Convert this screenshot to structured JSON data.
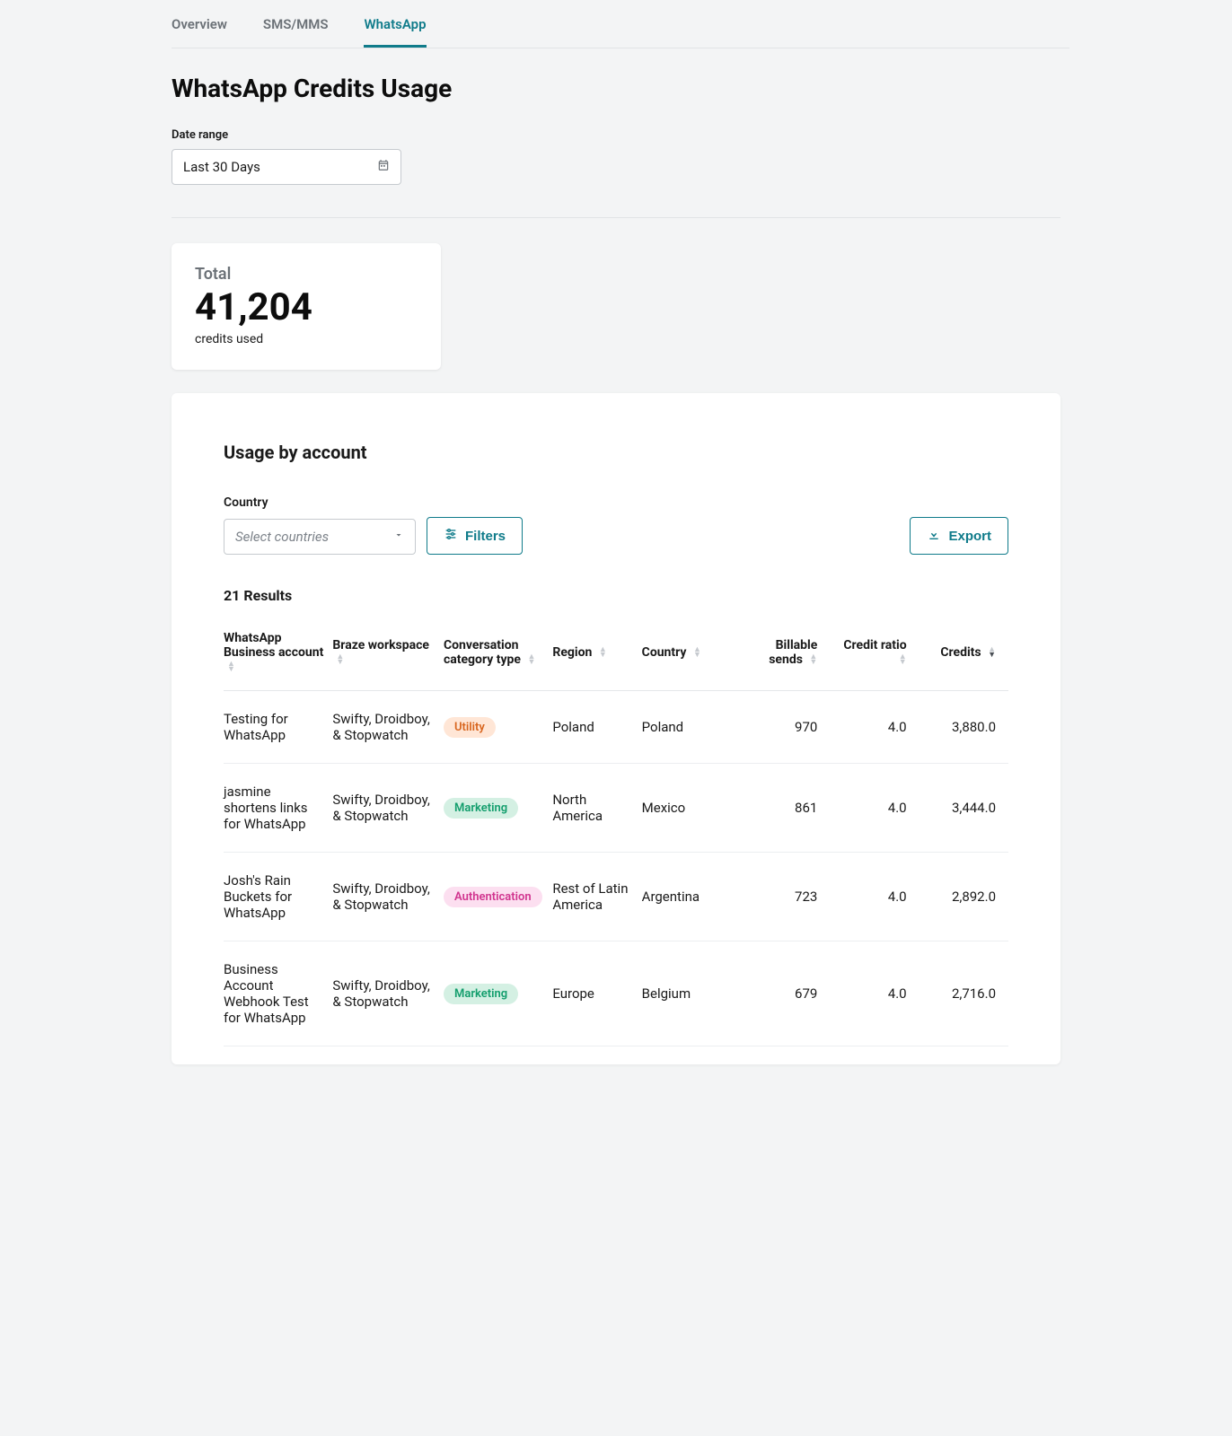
{
  "tabs": [
    {
      "label": "Overview",
      "active": false
    },
    {
      "label": "SMS/MMS",
      "active": false
    },
    {
      "label": "WhatsApp",
      "active": true
    }
  ],
  "page_title": "WhatsApp Credits Usage",
  "date_range": {
    "label": "Date range",
    "value": "Last 30 Days"
  },
  "total_card": {
    "label": "Total",
    "value": "41,204",
    "sub": "credits used"
  },
  "section_title": "Usage by account",
  "country_filter": {
    "label": "Country",
    "placeholder": "Select countries"
  },
  "buttons": {
    "filters": "Filters",
    "export": "Export"
  },
  "results_count": "21 Results",
  "columns": {
    "account": "WhatsApp Business account",
    "workspace": "Braze workspace",
    "type": "Conversation category type",
    "region": "Region",
    "country": "Country",
    "sends": "Billable sends",
    "ratio": "Credit ratio",
    "credits": "Credits"
  },
  "pill_labels": {
    "utility": "Utility",
    "marketing": "Marketing",
    "authentication": "Authentication"
  },
  "rows": [
    {
      "account": "Testing for WhatsApp",
      "workspace": "Swifty, Droidboy, & Stopwatch",
      "type": "utility",
      "region": "Poland",
      "country": "Poland",
      "sends": "970",
      "ratio": "4.0",
      "credits": "3,880.0"
    },
    {
      "account": "jasmine shortens links for WhatsApp",
      "workspace": "Swifty, Droidboy, & Stopwatch",
      "type": "marketing",
      "region": "North America",
      "country": "Mexico",
      "sends": "861",
      "ratio": "4.0",
      "credits": "3,444.0"
    },
    {
      "account": "Josh's Rain Buckets for WhatsApp",
      "workspace": "Swifty, Droidboy, & Stopwatch",
      "type": "authentication",
      "region": "Rest of Latin America",
      "country": "Argentina",
      "sends": "723",
      "ratio": "4.0",
      "credits": "2,892.0"
    },
    {
      "account": "Business Account Webhook Test for WhatsApp",
      "workspace": "Swifty, Droidboy, & Stopwatch",
      "type": "marketing",
      "region": "Europe",
      "country": "Belgium",
      "sends": "679",
      "ratio": "4.0",
      "credits": "2,716.0"
    }
  ]
}
